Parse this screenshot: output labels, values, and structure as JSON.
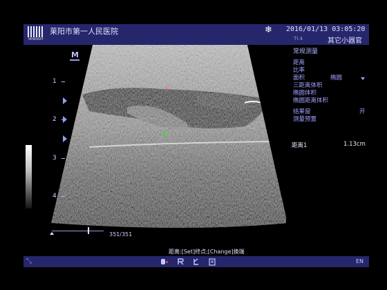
{
  "header": {
    "logo_text": "MINDRAY",
    "hospital": "莱阳市第一人民医院",
    "date": "2016/01/13",
    "time": "03:05:20",
    "ti_label": "TI.4",
    "preset": "其它小器官",
    "freeze_icon": "snowflake-icon"
  },
  "image": {
    "mode_label": "M",
    "depth_marks": [
      "1",
      "2",
      "3",
      "4"
    ],
    "cine": {
      "frame": "351/351"
    }
  },
  "menu": {
    "title": "常规测量",
    "items": [
      {
        "label": "距离"
      },
      {
        "label": "比率"
      },
      {
        "label": "面积",
        "value": "椭圆"
      },
      {
        "label": "三距离体积"
      },
      {
        "label": "椭圆体积"
      },
      {
        "label": "椭圆距离体积"
      }
    ],
    "result_window": {
      "label": "结果窗",
      "value": "开"
    },
    "preset_item": "测量预置"
  },
  "result": {
    "label": "距离1",
    "value": "1.13cm"
  },
  "hint": "距离:[Set]终点;[Change]换端",
  "footer": {
    "lang": "EN"
  },
  "colors": {
    "bar": "#26266c",
    "menu_text": "#9fa0ff"
  }
}
